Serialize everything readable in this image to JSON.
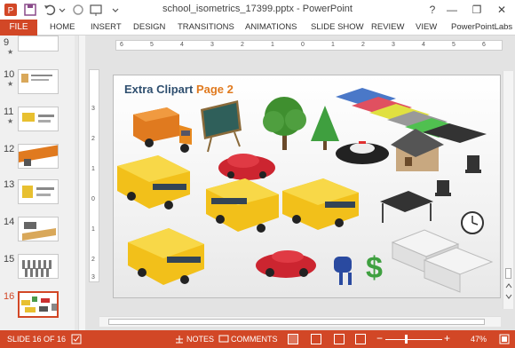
{
  "app": {
    "doc_title": "school_isometrics_17399.pptx - PowerPoint",
    "help": "?",
    "minimize": "—",
    "restore": "❐",
    "close": "✕"
  },
  "ribbon": {
    "file": "FILE",
    "tabs": [
      "HOME",
      "INSERT",
      "DESIGN",
      "TRANSITIONS",
      "ANIMATIONS",
      "SLIDE SHOW",
      "REVIEW",
      "VIEW",
      "PowerPointLabs"
    ]
  },
  "thumbnails": [
    {
      "num": "9",
      "star": "★"
    },
    {
      "num": "10",
      "star": "★"
    },
    {
      "num": "11",
      "star": "★"
    },
    {
      "num": "12",
      "star": ""
    },
    {
      "num": "13",
      "star": ""
    },
    {
      "num": "14",
      "star": ""
    },
    {
      "num": "15",
      "star": ""
    },
    {
      "num": "16",
      "star": ""
    }
  ],
  "ruler": {
    "h_labels": [
      "6",
      "5",
      "4",
      "3",
      "2",
      "1",
      "0",
      "1",
      "2",
      "3",
      "4",
      "5",
      "6"
    ],
    "v_labels": [
      "3",
      "2",
      "1",
      "0",
      "1",
      "2",
      "3"
    ]
  },
  "slide": {
    "title_main": "Extra Clipart",
    "title_accent": "Page 2"
  },
  "status": {
    "slide_info": "SLIDE 16 OF 16",
    "notes": "NOTES",
    "comments": "COMMENTS",
    "zoom_out": "−",
    "zoom_in": "+",
    "zoom": "47%"
  },
  "colors": {
    "accent": "#d24726",
    "title": "#2f4f6f",
    "title_accent": "#e07a1f"
  }
}
